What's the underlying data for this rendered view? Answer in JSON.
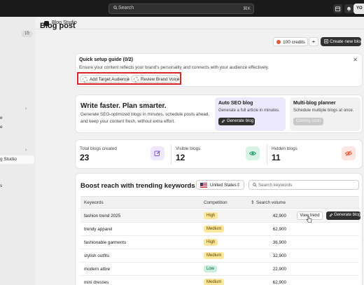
{
  "topbar": {
    "search_placeholder": "Search",
    "shortcut": "⌘K",
    "avatar_initials": "YO"
  },
  "sidebar": {
    "badge": "15",
    "truncated_items": [
      "e",
      "e"
    ],
    "active_item": "g Studio",
    "footer_item": "s"
  },
  "app": {
    "title": "Blog Studio"
  },
  "page": {
    "title": "Blog post",
    "credits_label": "100 credits",
    "plus_label": "+",
    "create_label": "Create new blog"
  },
  "quick_setup": {
    "title": "Quick setup guide (0/2)",
    "description": "Ensure your content reflects your brand's personality and connects with your audience effectively.",
    "close": "✕",
    "pills": [
      "Add Target Audience",
      "Review Brand Voice"
    ]
  },
  "promo": {
    "heading": "Write faster. Plan smarter.",
    "line1": "Generate SEO-optimized blogs in minutes, schedule posts ahead,",
    "line2": "and keep your content fresh, without extra effort.",
    "auto": {
      "title": "Auto SEO blog",
      "desc": "Generate a full article in minutes.",
      "button": "Generate blog"
    },
    "multi": {
      "title": "Multi-blog planner",
      "desc": "Schedule multiple blogs at once.",
      "button": "Coming soon"
    }
  },
  "stats": [
    {
      "label": "Total blogs created",
      "value": "23",
      "icon": "edit-icon",
      "color": "#ede8fd"
    },
    {
      "label": "Visible blogs",
      "value": "12",
      "icon": "eye-icon",
      "color": "#d9f3e6"
    },
    {
      "label": "Hidden blogs",
      "value": "11",
      "icon": "eye-off-icon",
      "color": "#fde6e1"
    }
  ],
  "keywords": {
    "heading": "Boost reach with trending keywords",
    "country": "United States",
    "search_placeholder": "Search keywords",
    "headers": {
      "keywords": "Keywords",
      "competition": "Competition",
      "volume": "Search volume"
    },
    "rows": [
      {
        "keyword": "fashion trend 2025",
        "competition": "High",
        "volume": "42,900"
      },
      {
        "keyword": "trendy apparel",
        "competition": "Medium",
        "volume": "62,900"
      },
      {
        "keyword": "fashionable garments",
        "competition": "High",
        "volume": "36,900"
      },
      {
        "keyword": "stylish outfits",
        "competition": "Medium",
        "volume": "32,900"
      },
      {
        "keyword": "modern attire",
        "competition": "Low",
        "volume": "22,900"
      },
      {
        "keyword": "mini dresses",
        "competition": "Medium",
        "volume": "62,900"
      }
    ],
    "row_actions": {
      "view_trend": "View trend",
      "generate": "Generate blog"
    }
  },
  "colors": {
    "topbar": "#1a1a1a",
    "accent_red": "#d9251c",
    "dark_button": "#303030"
  }
}
